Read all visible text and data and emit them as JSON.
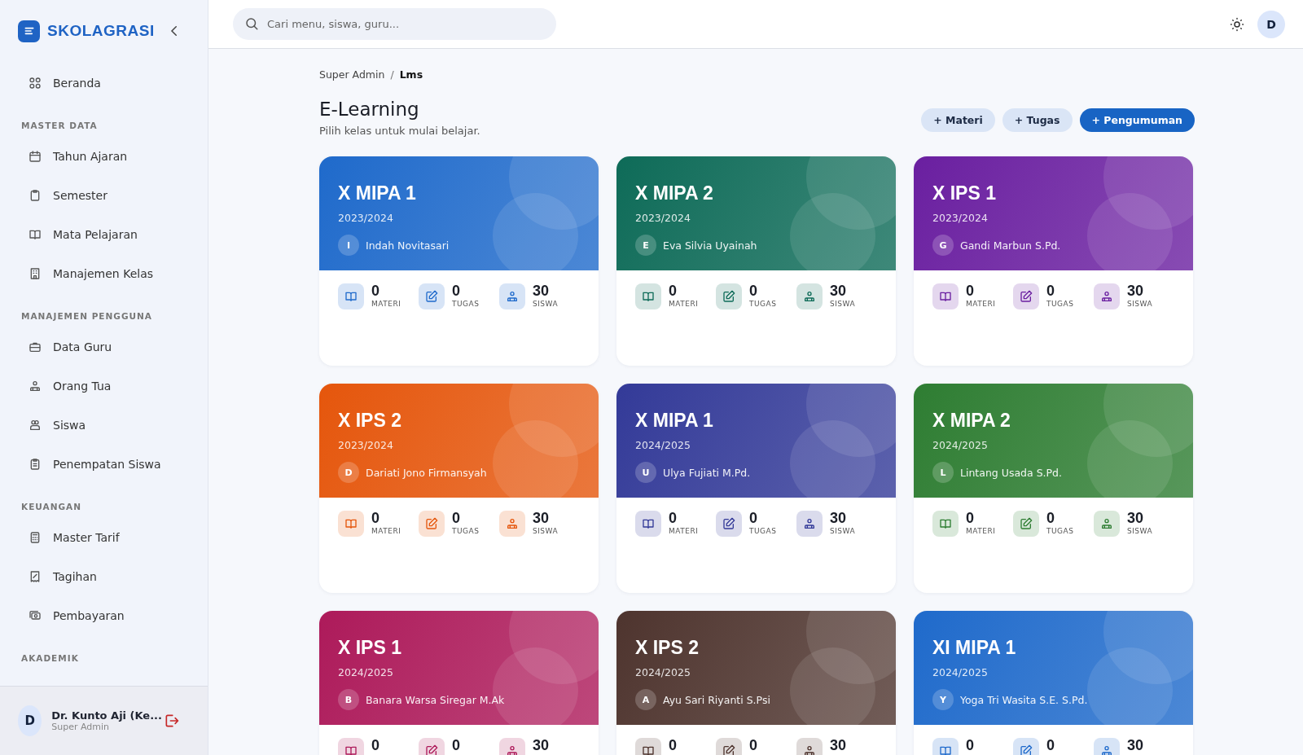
{
  "sidebar": {
    "brand": "SKOLAGRASI",
    "sections": [
      {
        "items": [
          {
            "label": "Beranda"
          }
        ]
      },
      {
        "heading": "MASTER DATA",
        "items": [
          {
            "label": "Tahun Ajaran"
          },
          {
            "label": "Semester"
          },
          {
            "label": "Mata Pelajaran"
          },
          {
            "label": "Manajemen Kelas"
          }
        ]
      },
      {
        "heading": "MANAJEMEN PENGGUNA",
        "items": [
          {
            "label": "Data Guru"
          },
          {
            "label": "Orang Tua"
          },
          {
            "label": "Siswa"
          },
          {
            "label": "Penempatan Siswa"
          }
        ]
      },
      {
        "heading": "KEUANGAN",
        "items": [
          {
            "label": "Master Tarif"
          },
          {
            "label": "Tagihan"
          },
          {
            "label": "Pembayaran"
          }
        ]
      },
      {
        "heading": "AKADEMIK"
      }
    ],
    "user": {
      "initial": "D",
      "name": "Dr. Kunto Aji (Ke...",
      "role": "Super Admin"
    }
  },
  "topbar": {
    "search": {
      "placeholder": "Cari menu, siswa, guru..."
    },
    "avatar": "D"
  },
  "breadcrumb": {
    "separator": "/",
    "items": [
      "Super Admin",
      "Lms"
    ]
  },
  "page": {
    "title": "E-Learning",
    "subtitle": "Pilih kelas untuk mulai belajar."
  },
  "actions": [
    {
      "label": "+ Materi",
      "primary": false
    },
    {
      "label": "+ Tugas",
      "primary": false
    },
    {
      "label": "+ Pengumuman",
      "primary": true
    }
  ],
  "classes": [
    {
      "name": "X MIPA 1",
      "year": "2023/2024",
      "initial": "I",
      "teacher": "Indah Novitasari",
      "color": "#1f6acb",
      "stats": [
        {
          "value": "0",
          "label": "MATERI"
        },
        {
          "value": "0",
          "label": "TUGAS"
        },
        {
          "value": "30",
          "label": "SISWA"
        }
      ]
    },
    {
      "name": "X MIPA 2",
      "year": "2023/2024",
      "initial": "E",
      "teacher": "Eva Silvia Uyainah",
      "color": "#0e6b58",
      "stats": [
        {
          "value": "0",
          "label": "MATERI"
        },
        {
          "value": "0",
          "label": "TUGAS"
        },
        {
          "value": "30",
          "label": "SISWA"
        }
      ]
    },
    {
      "name": "X IPS 1",
      "year": "2023/2024",
      "initial": "G",
      "teacher": "Gandi Marbun S.Pd.",
      "color": "#6a1fa0",
      "stats": [
        {
          "value": "0",
          "label": "MATERI"
        },
        {
          "value": "0",
          "label": "TUGAS"
        },
        {
          "value": "30",
          "label": "SISWA"
        }
      ]
    },
    {
      "name": "X IPS 2",
      "year": "2023/2024",
      "initial": "D",
      "teacher": "Dariati Jono Firmansyah",
      "color": "#e5560c",
      "stats": [
        {
          "value": "0",
          "label": "MATERI"
        },
        {
          "value": "0",
          "label": "TUGAS"
        },
        {
          "value": "30",
          "label": "SISWA"
        }
      ]
    },
    {
      "name": "X MIPA 1",
      "year": "2024/2025",
      "initial": "U",
      "teacher": "Ulya Fujiati M.Pd.",
      "color": "#333a98",
      "stats": [
        {
          "value": "0",
          "label": "MATERI"
        },
        {
          "value": "0",
          "label": "TUGAS"
        },
        {
          "value": "30",
          "label": "SISWA"
        }
      ]
    },
    {
      "name": "X MIPA 2",
      "year": "2024/2025",
      "initial": "L",
      "teacher": "Lintang Usada S.Pd.",
      "color": "#2e7d32",
      "stats": [
        {
          "value": "0",
          "label": "MATERI"
        },
        {
          "value": "0",
          "label": "TUGAS"
        },
        {
          "value": "30",
          "label": "SISWA"
        }
      ]
    },
    {
      "name": "X IPS 1",
      "year": "2024/2025",
      "initial": "B",
      "teacher": "Banara Warsa Siregar M.Ak",
      "color": "#ad1a5a",
      "stats": [
        {
          "value": "0"
        },
        {
          "value": "0"
        },
        {
          "value": "30"
        }
      ]
    },
    {
      "name": "X IPS 2",
      "year": "2024/2025",
      "initial": "A",
      "teacher": "Ayu Sari Riyanti S.Psi",
      "color": "#4e342e",
      "stats": [
        {
          "value": "0"
        },
        {
          "value": "0"
        },
        {
          "value": "30"
        }
      ]
    },
    {
      "name": "XI MIPA 1",
      "year": "2024/2025",
      "initial": "Y",
      "teacher": "Yoga Tri Wasita S.E. S.Pd.",
      "color": "#1f6acb",
      "stats": [
        {
          "value": "0"
        },
        {
          "value": "0"
        },
        {
          "value": "30"
        }
      ]
    }
  ]
}
